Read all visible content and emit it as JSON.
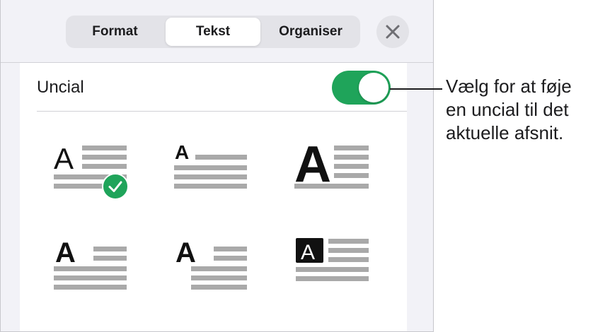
{
  "tabs": [
    {
      "label": "Format",
      "selected": false
    },
    {
      "label": "Tekst",
      "selected": true
    },
    {
      "label": "Organiser",
      "selected": false
    }
  ],
  "close_icon": "close-x-icon",
  "uncial": {
    "label": "Uncial",
    "enabled": true,
    "toggle_color": "#1fa45a"
  },
  "styles": [
    {
      "glyph": "A",
      "variant": "thin-large-three-lines",
      "selected": true,
      "check_icon": "checkmark-circle-icon"
    },
    {
      "glyph": "A",
      "variant": "small-one-line",
      "selected": false
    },
    {
      "glyph": "A",
      "variant": "bold-large-three-lines",
      "selected": false
    },
    {
      "glyph": "A",
      "variant": "bold-two-lines",
      "selected": false
    },
    {
      "glyph": "A",
      "variant": "bold-two-lines-offset",
      "selected": false
    },
    {
      "glyph": "A",
      "variant": "boxed-inverted",
      "selected": false
    }
  ],
  "callout": {
    "lines": [
      "Vælg for at føje",
      "en uncial til det",
      "aktuelle afsnit."
    ]
  },
  "colors": {
    "accent": "#1fa45a",
    "line": "#a9a9a9",
    "glyph": "#111111"
  }
}
